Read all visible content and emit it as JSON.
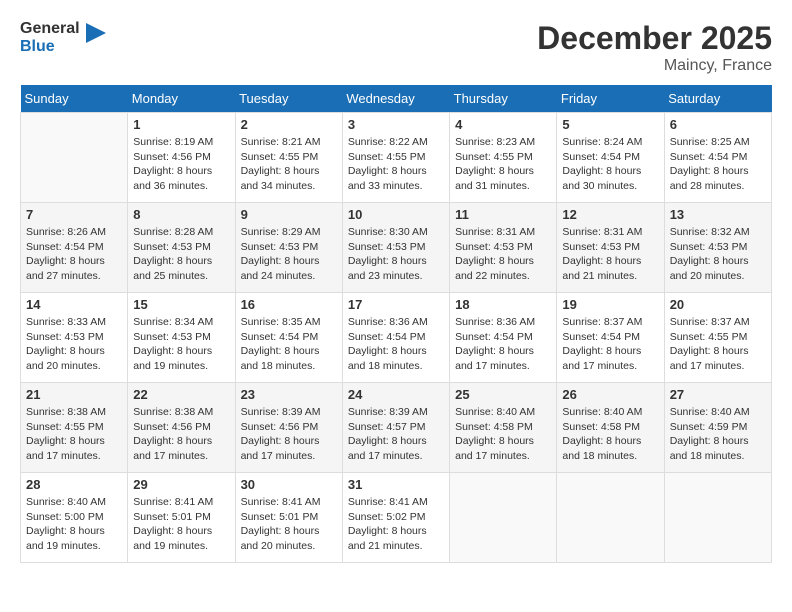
{
  "header": {
    "logo_line1": "General",
    "logo_line2": "Blue",
    "month": "December 2025",
    "location": "Maincy, France"
  },
  "weekdays": [
    "Sunday",
    "Monday",
    "Tuesday",
    "Wednesday",
    "Thursday",
    "Friday",
    "Saturday"
  ],
  "weeks": [
    [
      {
        "day": "",
        "info": ""
      },
      {
        "day": "1",
        "info": "Sunrise: 8:19 AM\nSunset: 4:56 PM\nDaylight: 8 hours\nand 36 minutes."
      },
      {
        "day": "2",
        "info": "Sunrise: 8:21 AM\nSunset: 4:55 PM\nDaylight: 8 hours\nand 34 minutes."
      },
      {
        "day": "3",
        "info": "Sunrise: 8:22 AM\nSunset: 4:55 PM\nDaylight: 8 hours\nand 33 minutes."
      },
      {
        "day": "4",
        "info": "Sunrise: 8:23 AM\nSunset: 4:55 PM\nDaylight: 8 hours\nand 31 minutes."
      },
      {
        "day": "5",
        "info": "Sunrise: 8:24 AM\nSunset: 4:54 PM\nDaylight: 8 hours\nand 30 minutes."
      },
      {
        "day": "6",
        "info": "Sunrise: 8:25 AM\nSunset: 4:54 PM\nDaylight: 8 hours\nand 28 minutes."
      }
    ],
    [
      {
        "day": "7",
        "info": "Sunrise: 8:26 AM\nSunset: 4:54 PM\nDaylight: 8 hours\nand 27 minutes."
      },
      {
        "day": "8",
        "info": "Sunrise: 8:28 AM\nSunset: 4:53 PM\nDaylight: 8 hours\nand 25 minutes."
      },
      {
        "day": "9",
        "info": "Sunrise: 8:29 AM\nSunset: 4:53 PM\nDaylight: 8 hours\nand 24 minutes."
      },
      {
        "day": "10",
        "info": "Sunrise: 8:30 AM\nSunset: 4:53 PM\nDaylight: 8 hours\nand 23 minutes."
      },
      {
        "day": "11",
        "info": "Sunrise: 8:31 AM\nSunset: 4:53 PM\nDaylight: 8 hours\nand 22 minutes."
      },
      {
        "day": "12",
        "info": "Sunrise: 8:31 AM\nSunset: 4:53 PM\nDaylight: 8 hours\nand 21 minutes."
      },
      {
        "day": "13",
        "info": "Sunrise: 8:32 AM\nSunset: 4:53 PM\nDaylight: 8 hours\nand 20 minutes."
      }
    ],
    [
      {
        "day": "14",
        "info": "Sunrise: 8:33 AM\nSunset: 4:53 PM\nDaylight: 8 hours\nand 20 minutes."
      },
      {
        "day": "15",
        "info": "Sunrise: 8:34 AM\nSunset: 4:53 PM\nDaylight: 8 hours\nand 19 minutes."
      },
      {
        "day": "16",
        "info": "Sunrise: 8:35 AM\nSunset: 4:54 PM\nDaylight: 8 hours\nand 18 minutes."
      },
      {
        "day": "17",
        "info": "Sunrise: 8:36 AM\nSunset: 4:54 PM\nDaylight: 8 hours\nand 18 minutes."
      },
      {
        "day": "18",
        "info": "Sunrise: 8:36 AM\nSunset: 4:54 PM\nDaylight: 8 hours\nand 17 minutes."
      },
      {
        "day": "19",
        "info": "Sunrise: 8:37 AM\nSunset: 4:54 PM\nDaylight: 8 hours\nand 17 minutes."
      },
      {
        "day": "20",
        "info": "Sunrise: 8:37 AM\nSunset: 4:55 PM\nDaylight: 8 hours\nand 17 minutes."
      }
    ],
    [
      {
        "day": "21",
        "info": "Sunrise: 8:38 AM\nSunset: 4:55 PM\nDaylight: 8 hours\nand 17 minutes."
      },
      {
        "day": "22",
        "info": "Sunrise: 8:38 AM\nSunset: 4:56 PM\nDaylight: 8 hours\nand 17 minutes."
      },
      {
        "day": "23",
        "info": "Sunrise: 8:39 AM\nSunset: 4:56 PM\nDaylight: 8 hours\nand 17 minutes."
      },
      {
        "day": "24",
        "info": "Sunrise: 8:39 AM\nSunset: 4:57 PM\nDaylight: 8 hours\nand 17 minutes."
      },
      {
        "day": "25",
        "info": "Sunrise: 8:40 AM\nSunset: 4:58 PM\nDaylight: 8 hours\nand 17 minutes."
      },
      {
        "day": "26",
        "info": "Sunrise: 8:40 AM\nSunset: 4:58 PM\nDaylight: 8 hours\nand 18 minutes."
      },
      {
        "day": "27",
        "info": "Sunrise: 8:40 AM\nSunset: 4:59 PM\nDaylight: 8 hours\nand 18 minutes."
      }
    ],
    [
      {
        "day": "28",
        "info": "Sunrise: 8:40 AM\nSunset: 5:00 PM\nDaylight: 8 hours\nand 19 minutes."
      },
      {
        "day": "29",
        "info": "Sunrise: 8:41 AM\nSunset: 5:01 PM\nDaylight: 8 hours\nand 19 minutes."
      },
      {
        "day": "30",
        "info": "Sunrise: 8:41 AM\nSunset: 5:01 PM\nDaylight: 8 hours\nand 20 minutes."
      },
      {
        "day": "31",
        "info": "Sunrise: 8:41 AM\nSunset: 5:02 PM\nDaylight: 8 hours\nand 21 minutes."
      },
      {
        "day": "",
        "info": ""
      },
      {
        "day": "",
        "info": ""
      },
      {
        "day": "",
        "info": ""
      }
    ]
  ]
}
